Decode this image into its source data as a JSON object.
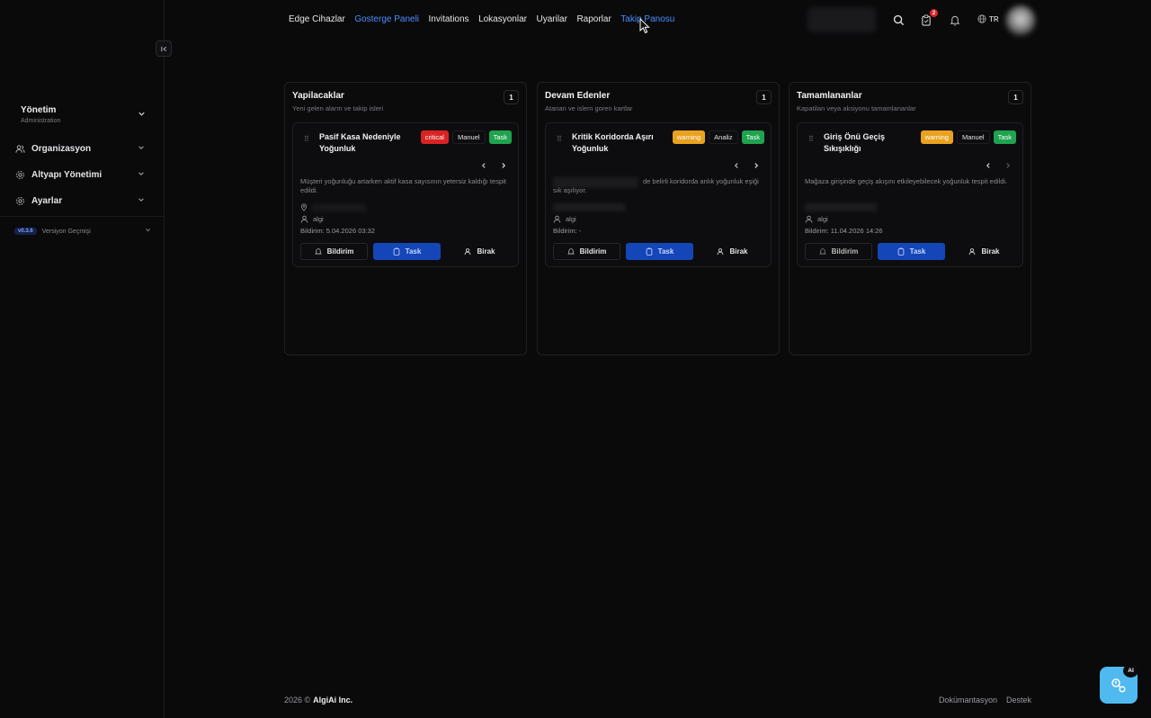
{
  "sidebar": {
    "org": {
      "title": "Yönetim",
      "subtitle": "Administration"
    },
    "items": [
      {
        "label": "Organizasyon",
        "icon": "users-icon"
      },
      {
        "label": "Altyapı Yönetimi",
        "icon": "gear-icon"
      },
      {
        "label": "Ayarlar",
        "icon": "gear-icon"
      }
    ],
    "version": {
      "badge": "v0.3.6",
      "label": "Versiyon Geçmişi"
    }
  },
  "topnav": {
    "items": [
      "Edge Cihazlar",
      "Gosterge Paneli",
      "Invitations",
      "Lokasyonlar",
      "Uyarilar",
      "Raporlar",
      "Takip Panosu"
    ],
    "active_index": 1
  },
  "header": {
    "notification_count": "2",
    "language": "TR"
  },
  "columns": [
    {
      "title": "Yapilacaklar",
      "subtitle": "Yeni gelen alarm ve takip isleri",
      "count": "1",
      "card": {
        "title": "Pasif Kasa Nedeniyle Yoğunluk",
        "severity": "critical",
        "mode": "Manuel",
        "type": "Task",
        "description": "Müşteri yoğunluğu artarken aktif kasa sayısının yetersiz kaldığı tespit edildi.",
        "user": "algi",
        "notified": "Bildirim: 5.04.2026 03:32"
      }
    },
    {
      "title": "Devam Edenler",
      "subtitle": "Atanan ve islem goren kartlar",
      "count": "1",
      "card": {
        "title": "Kritik Koridorda Aşırı Yoğunluk",
        "severity": "warning",
        "mode": "Analiz",
        "type": "Task",
        "description": "de belirli koridorda anlık yoğunluk eşiği sık aşılıyor.",
        "user": "algi",
        "notified": "Bildirim: -"
      }
    },
    {
      "title": "Tamamlananlar",
      "subtitle": "Kapatilan veya aksiyonu tamamlananlar",
      "count": "1",
      "card": {
        "title": "Giriş Önü Geçiş Sıkışıklığı",
        "severity": "warning",
        "mode": "Manuel",
        "type": "Task",
        "description": "Mağaza girişinde geçiş akışını etkileyebilecek yoğunluk tespit edildi.",
        "user": "algi",
        "notified": "Bildirim: 11.04.2026 14:26"
      }
    }
  ],
  "card_actions": {
    "notify": "Bildirim",
    "task": "Task",
    "leave": "Birak"
  },
  "footer": {
    "year": "2026 ©",
    "company": "AlgiAi Inc.",
    "links": [
      "Dokümantasyon",
      "Destek"
    ]
  },
  "ai_button": {
    "badge": "AI"
  },
  "colors": {
    "accent": "#4d8dff",
    "critical": "#d92323",
    "warning": "#e9a21f",
    "task": "#1fa34f",
    "primary_button": "#1446b8",
    "ai": "#4fb9f0"
  }
}
